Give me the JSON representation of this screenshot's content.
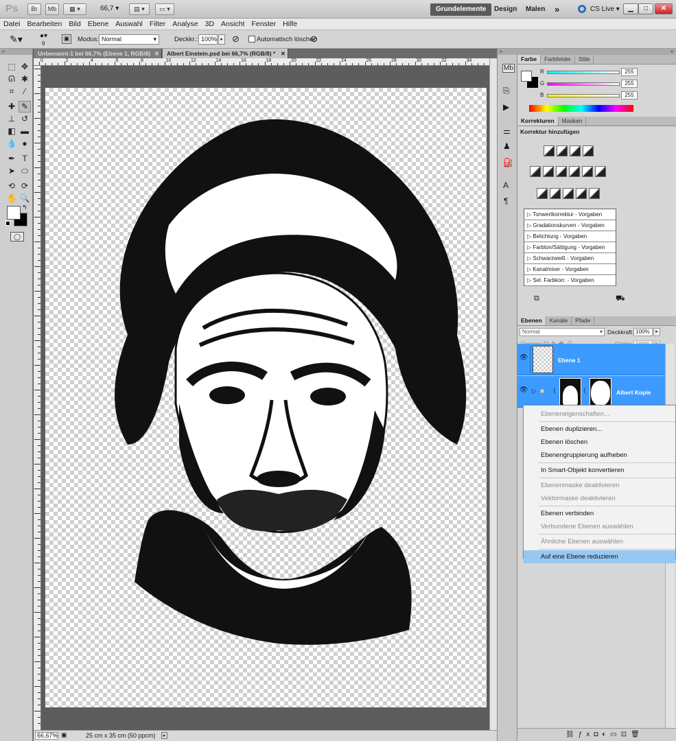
{
  "app": {
    "logo": "Ps",
    "zoom": "66,7",
    "workspaces": [
      "Grundelemente",
      "Design",
      "Malen"
    ],
    "more": "»",
    "cslive": "CS Live",
    "brand_blue": "#3d9bff"
  },
  "menu": [
    "Datei",
    "Bearbeiten",
    "Bild",
    "Ebene",
    "Auswahl",
    "Filter",
    "Analyse",
    "3D",
    "Ansicht",
    "Fenster",
    "Hilfe"
  ],
  "options": {
    "brush_size": "9",
    "mode_label": "Modus:",
    "mode_value": "Normal",
    "opacity_label": "Deckkr.:",
    "opacity_value": "100%",
    "auto_erase": "Automatisch löschen"
  },
  "tabs": [
    {
      "label": "Unbenannt-1 bei 66,7% (Ebene 1, RGB/8)"
    },
    {
      "label": "Albert Einstein.psd bei 66,7% (RGB/8) *"
    }
  ],
  "ruler": [
    "0",
    "2",
    "4",
    "6",
    "8",
    "10",
    "12",
    "14",
    "16",
    "18",
    "20",
    "22",
    "24",
    "26",
    "28",
    "30",
    "32",
    "34"
  ],
  "status": {
    "zoom": "66,67%",
    "size": "25 cm x 35 cm (50 ppcm)"
  },
  "color_panel": {
    "tabs": [
      "Farbe",
      "Farbfelder",
      "Stile"
    ],
    "r": "255",
    "g": "255",
    "b": "255"
  },
  "adjust_panel": {
    "tabs": [
      "Korrekturen",
      "Masken"
    ],
    "heading": "Korrektur hinzufügen",
    "presets": [
      "Tonwertkorrektur - Vorgaben",
      "Gradationskurven - Vorgaben",
      "Belichtung - Vorgaben",
      "Farbton/Sättigung - Vorgaben",
      "Schwarzweiß - Vorgaben",
      "Kanalmixer - Vorgaben",
      "Sel. Farbkorr. - Vorgaben"
    ]
  },
  "layers_panel": {
    "tabs": [
      "Ebenen",
      "Kanäle",
      "Pfade"
    ],
    "blend": "Normal",
    "opacity_label": "Deckkraft:",
    "opacity": "100%",
    "lock_label": "Fixieren:",
    "fill_label": "Fläche:",
    "fill": "100%",
    "layers": [
      {
        "name": "Ebene 1"
      },
      {
        "name": "Albert Kopie"
      }
    ]
  },
  "context_menu": [
    {
      "label": "Ebeneneigenschaften...",
      "disabled": true
    },
    {
      "sep": true
    },
    {
      "label": "Ebenen duplizieren...",
      "disabled": false
    },
    {
      "label": "Ebenen löschen",
      "disabled": false
    },
    {
      "label": "Ebenengruppierung aufheben",
      "disabled": false
    },
    {
      "sep": true
    },
    {
      "label": "In Smart-Objekt konvertieren",
      "disabled": false
    },
    {
      "sep": true
    },
    {
      "label": "Ebenenmaske deaktivieren",
      "disabled": true
    },
    {
      "label": "Vektormaske deaktivieren",
      "disabled": true
    },
    {
      "sep": true
    },
    {
      "label": "Ebenen verbinden",
      "disabled": false
    },
    {
      "label": "Verbundene Ebenen auswählen",
      "disabled": true
    },
    {
      "sep": true
    },
    {
      "label": "Ähnliche Ebenen auswählen",
      "disabled": true
    },
    {
      "sep": true
    },
    {
      "label": "Auf eine Ebene reduzieren",
      "disabled": false,
      "highlight": true
    }
  ]
}
